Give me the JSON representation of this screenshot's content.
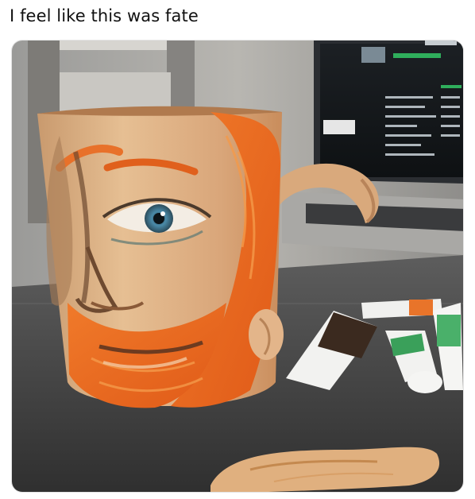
{
  "post": {
    "caption": "I feel like this was fate"
  },
  "photo": {
    "subject": "hand-painted-van-gogh-face-mug"
  }
}
